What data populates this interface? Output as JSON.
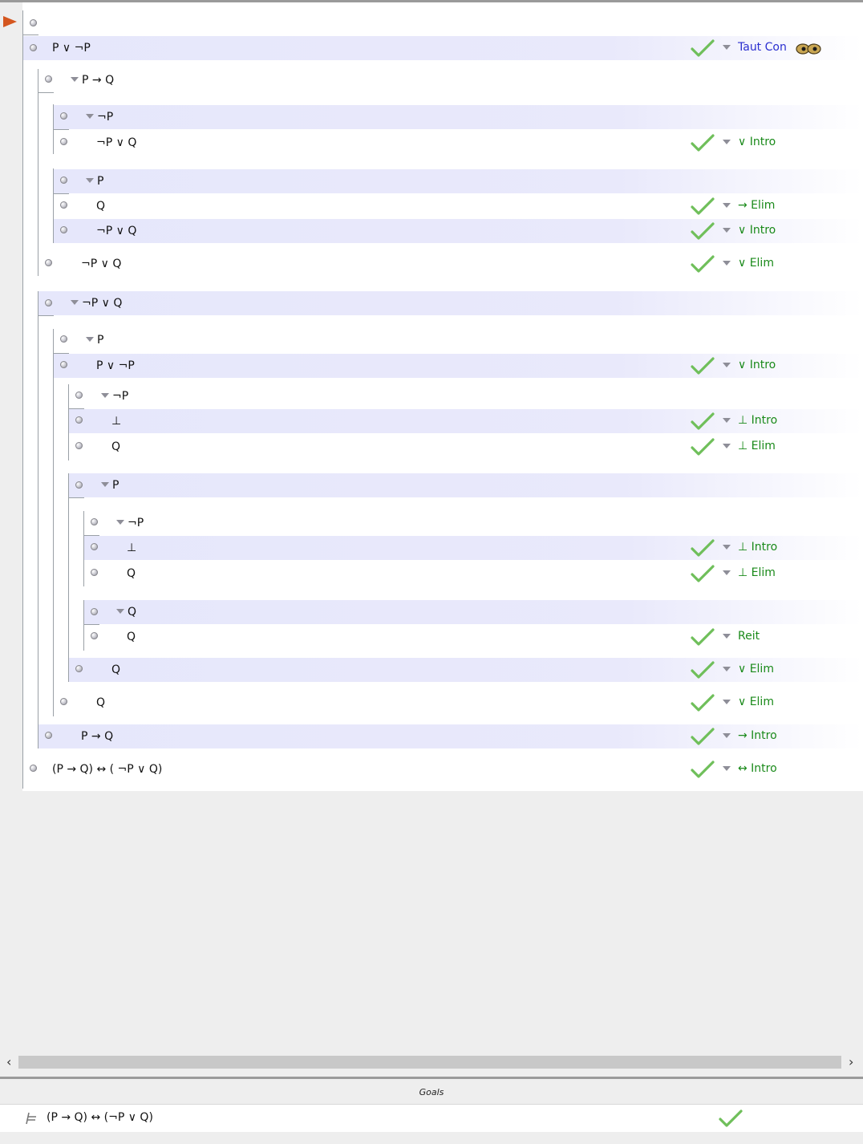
{
  "proof": {
    "lines": [
      {
        "formula": "",
        "rule": ""
      },
      {
        "formula": "P ∨ ¬P",
        "rule": "Taut Con",
        "checked": true,
        "rule_color": "blue"
      },
      {
        "formula": "P → Q",
        "rule": "",
        "assumption": true
      },
      {
        "formula": "¬P",
        "rule": "",
        "assumption": true
      },
      {
        "formula": "¬P ∨ Q",
        "rule": "∨ Intro",
        "checked": true
      },
      {
        "formula": "P",
        "rule": "",
        "assumption": true
      },
      {
        "formula": "Q",
        "rule": "→ Elim",
        "checked": true
      },
      {
        "formula": "¬P ∨ Q",
        "rule": "∨ Intro",
        "checked": true
      },
      {
        "formula": "¬P ∨ Q",
        "rule": "∨ Elim",
        "checked": true
      },
      {
        "formula": "¬P ∨ Q",
        "rule": "",
        "assumption": true
      },
      {
        "formula": "P",
        "rule": "",
        "assumption": true
      },
      {
        "formula": "P ∨ ¬P",
        "rule": "∨ Intro",
        "checked": true
      },
      {
        "formula": "¬P",
        "rule": "",
        "assumption": true
      },
      {
        "formula": "⊥",
        "rule": "⊥ Intro",
        "checked": true
      },
      {
        "formula": "Q",
        "rule": "⊥ Elim",
        "checked": true
      },
      {
        "formula": "P",
        "rule": "",
        "assumption": true
      },
      {
        "formula": "¬P",
        "rule": "",
        "assumption": true
      },
      {
        "formula": "⊥",
        "rule": "⊥ Intro",
        "checked": true
      },
      {
        "formula": "Q",
        "rule": "⊥ Elim",
        "checked": true
      },
      {
        "formula": "Q",
        "rule": "",
        "assumption": true
      },
      {
        "formula": "Q",
        "rule": "Reit",
        "checked": true
      },
      {
        "formula": "Q",
        "rule": "∨ Elim",
        "checked": true
      },
      {
        "formula": "Q",
        "rule": "∨ Elim",
        "checked": true
      },
      {
        "formula": "P → Q",
        "rule": "→ Intro",
        "checked": true
      },
      {
        "formula": "(P → Q) ↔ ( ¬P ∨ Q)",
        "rule": "↔ Intro",
        "checked": true
      }
    ]
  },
  "scrollbar": {
    "left_arrow": "‹",
    "right_arrow": "›"
  },
  "goals": {
    "title": "Goals",
    "items": [
      {
        "formula": "(P → Q) ↔ (¬P ∨ Q)",
        "satisfied": true
      }
    ]
  },
  "colors": {
    "check": "#6fbf5a",
    "rule": "#1a8a1a",
    "rule_special": "#2b2fd0",
    "focus_arrow": "#d4561f"
  },
  "icons": {
    "focus": "focus-arrow-icon",
    "check": "checkmark-icon",
    "goal": "turnstile-icon",
    "rule_extra": "eyes-icon"
  }
}
